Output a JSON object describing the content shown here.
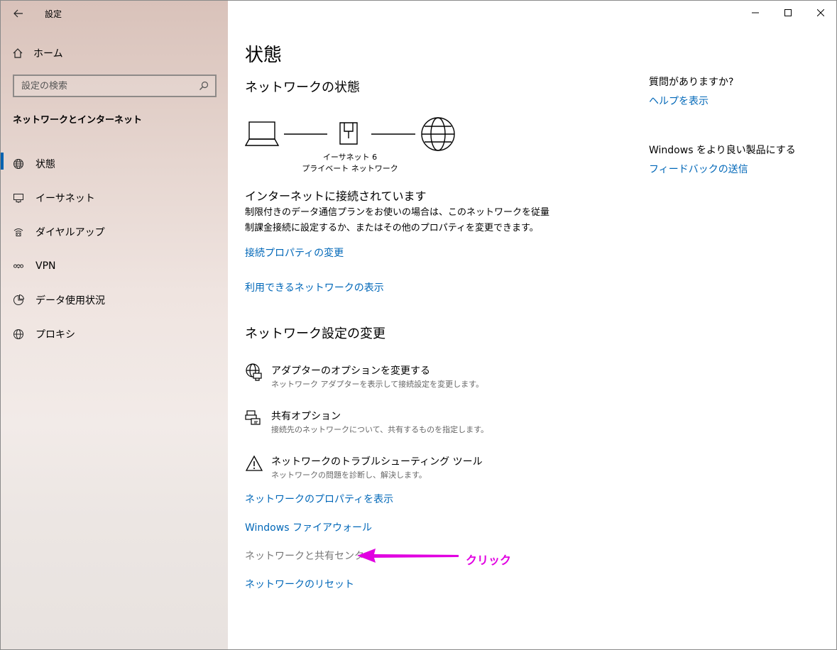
{
  "window": {
    "title": "設定",
    "controls": [
      "minimize-icon",
      "maximize-icon",
      "close-icon"
    ]
  },
  "sidebar": {
    "home_label": "ホーム",
    "search_placeholder": "設定の検索",
    "section_title": "ネットワークとインターネット",
    "items": [
      {
        "label": "状態",
        "icon": "status-globe-icon",
        "active": true
      },
      {
        "label": "イーサネット",
        "icon": "ethernet-icon",
        "active": false
      },
      {
        "label": "ダイヤルアップ",
        "icon": "dialup-icon",
        "active": false
      },
      {
        "label": "VPN",
        "icon": "vpn-icon",
        "active": false
      },
      {
        "label": "データ使用状況",
        "icon": "data-usage-icon",
        "active": false
      },
      {
        "label": "プロキシ",
        "icon": "proxy-globe-icon",
        "active": false
      }
    ]
  },
  "main": {
    "page_title": "状態",
    "network_status_title": "ネットワークの状態",
    "diagram": {
      "adapter_name": "イーサネット 6",
      "network_name": "プライベート ネットワーク"
    },
    "status_heading": "インターネットに接続されています",
    "status_description": "制限付きのデータ通信プランをお使いの場合は、このネットワークを従量制課金接続に設定するか、またはその他のプロパティを変更できます。",
    "link_connection_properties": "接続プロパティの変更",
    "link_available_networks": "利用できるネットワークの表示",
    "change_settings_title": "ネットワーク設定の変更",
    "options": [
      {
        "title": "アダプターのオプションを変更する",
        "desc": "ネットワーク アダプターを表示して接続設定を変更します。",
        "icon": "adapter-icon"
      },
      {
        "title": "共有オプション",
        "desc": "接続先のネットワークについて、共有するものを指定します。",
        "icon": "sharing-icon"
      },
      {
        "title": "ネットワークのトラブルシューティング ツール",
        "desc": "ネットワークの問題を診断し、解決します。",
        "icon": "warning-icon"
      }
    ],
    "link_network_properties": "ネットワークのプロパティを表示",
    "link_firewall": "Windows ファイアウォール",
    "link_sharing_center": "ネットワークと共有センター",
    "link_reset": "ネットワークのリセット"
  },
  "right": {
    "question": "質問がありますか?",
    "help_link": "ヘルプを表示",
    "improve": "Windows をより良い製品にする",
    "feedback_link": "フィードバックの送信"
  },
  "annotation": {
    "text": "クリック",
    "color": "#e100e1"
  },
  "colors": {
    "accent": "#0067b8",
    "active_indicator": "#0063b1"
  }
}
